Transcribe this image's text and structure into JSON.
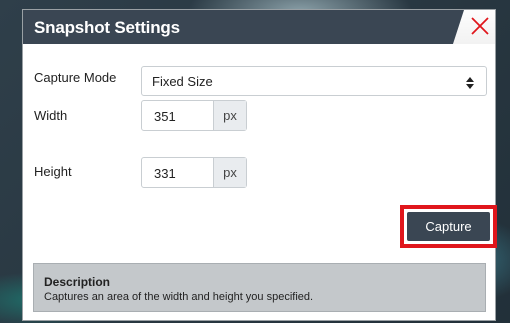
{
  "dialog": {
    "title": "Snapshot Settings",
    "close_icon": "close-x-icon",
    "close_color": "#e0161c"
  },
  "capture_mode": {
    "label": "Capture Mode",
    "value": "Fixed Size",
    "arrow_icon": "select-up-down-arrows-icon"
  },
  "width": {
    "label": "Width",
    "value": "351",
    "unit": "px"
  },
  "height": {
    "label": "Height",
    "value": "331",
    "unit": "px"
  },
  "capture_button": {
    "label": "Capture",
    "highlight_color": "#e0161c"
  },
  "description": {
    "title": "Description",
    "text": "Captures an area of the width and height you specified."
  },
  "colors": {
    "titlebar": "#3a4653",
    "button": "#3a4653",
    "description_bg": "#c4c8cb"
  }
}
